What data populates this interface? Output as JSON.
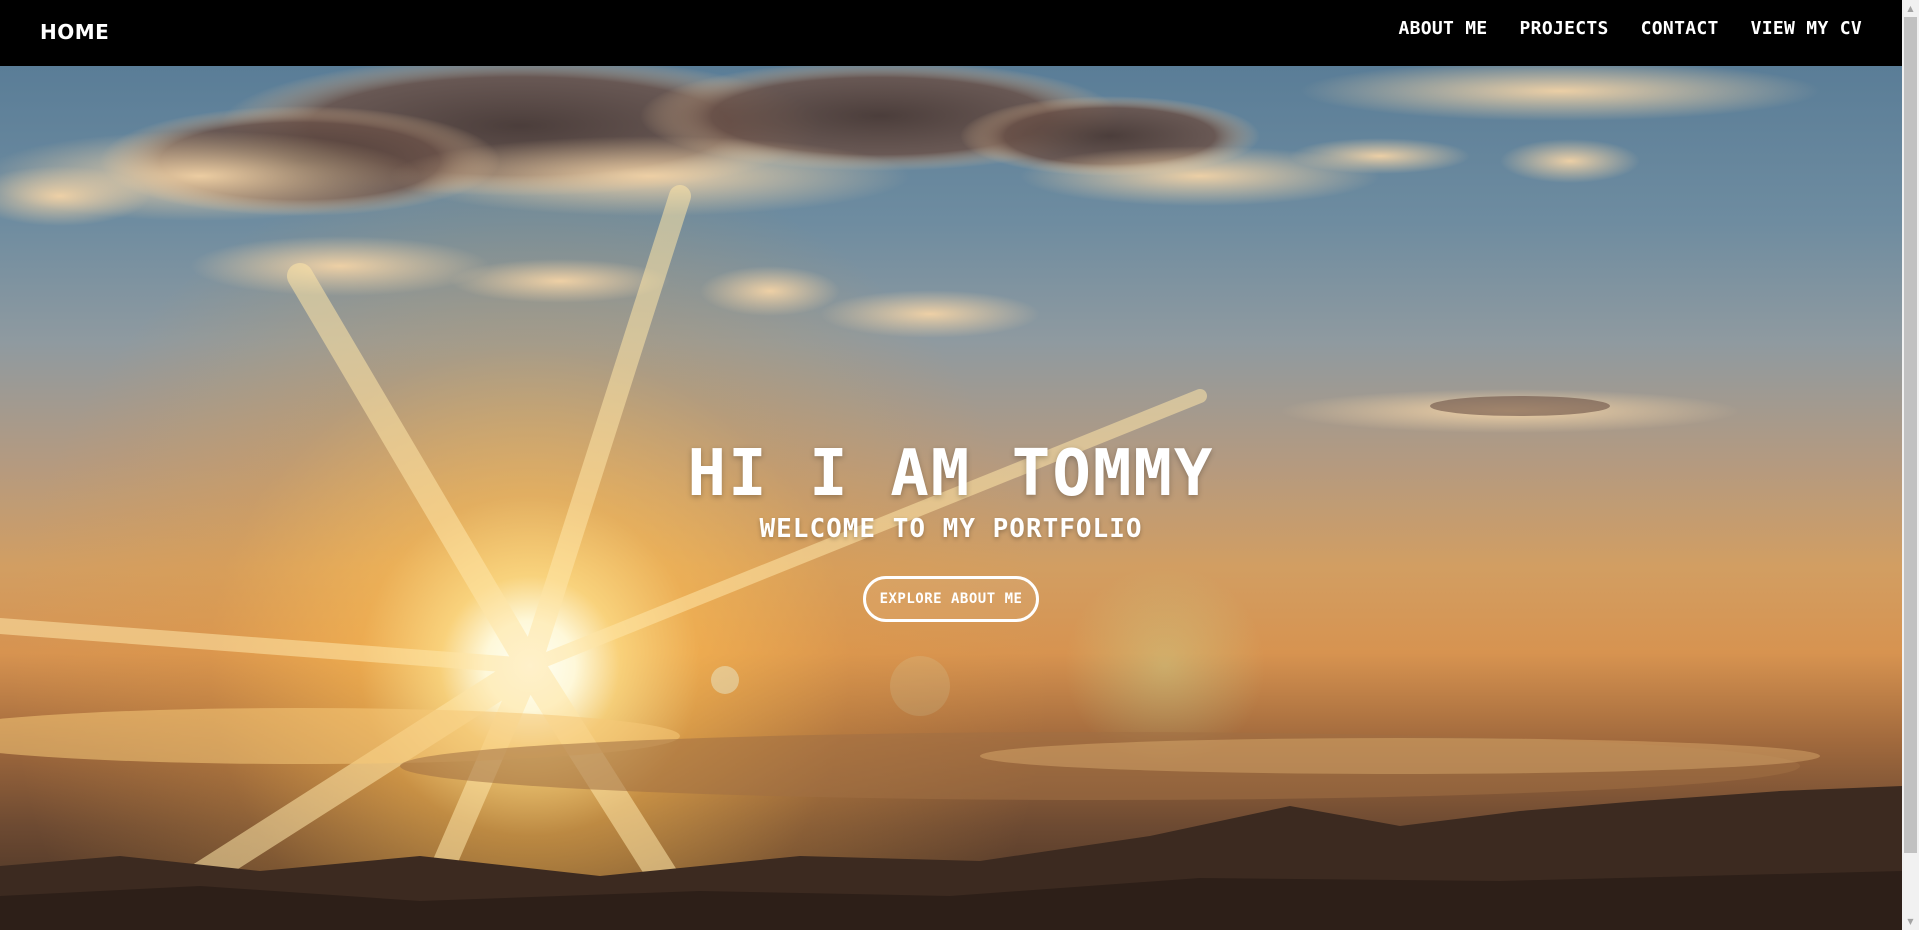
{
  "navbar": {
    "brand": "HOME",
    "links": [
      {
        "label": "ABOUT ME"
      },
      {
        "label": "PROJECTS"
      },
      {
        "label": "CONTACT"
      },
      {
        "label": "VIEW MY CV"
      }
    ]
  },
  "hero": {
    "title": "HI I AM TOMMY",
    "subtitle": "WELCOME TO MY PORTFOLIO",
    "button_label": "EXPLORE ABOUT ME",
    "background": "sunset-sky-photo"
  },
  "scrollbar": {
    "up_icon": "▲",
    "down_icon": "▼"
  },
  "colors": {
    "navbar_bg": "#000000",
    "text": "#ffffff",
    "sky_top": "#5a7d97",
    "sky_mid": "#d29e62",
    "horizon": "#3f2d22"
  }
}
